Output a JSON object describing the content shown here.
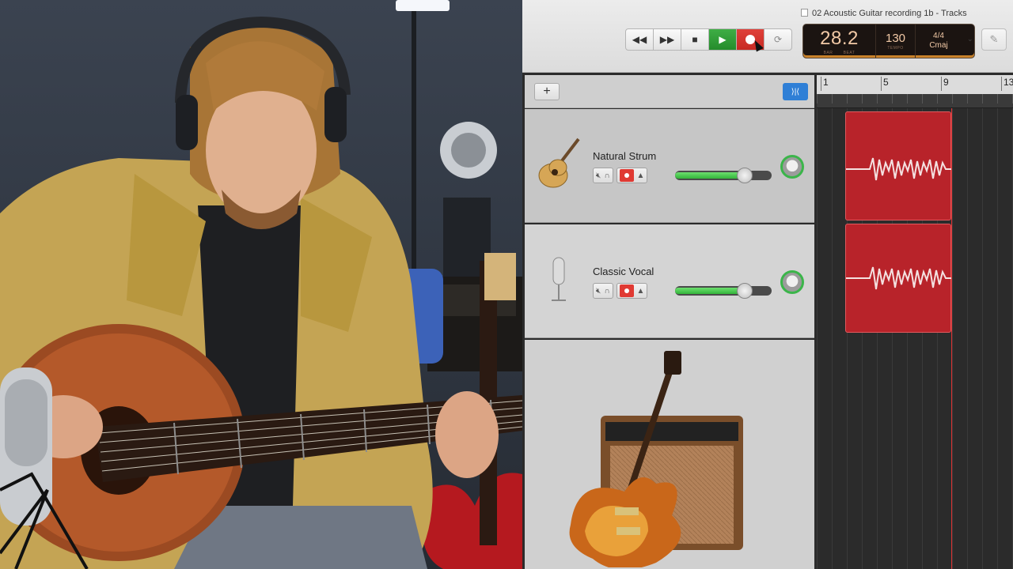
{
  "window": {
    "title": "02 Acoustic Guitar recording 1b - Tracks"
  },
  "transport": {
    "rewind_icon": "rewind-icon",
    "forward_icon": "fast-forward-icon",
    "stop_icon": "stop-icon",
    "play_icon": "play-icon",
    "record_icon": "record-icon",
    "cycle_icon": "cycle-icon"
  },
  "lcd": {
    "position": "28.2",
    "bar_label": "BAR",
    "beat_label": "BEAT",
    "tempo": "130",
    "tempo_label": "TEMPO",
    "time_signature": "4/4",
    "key": "Cmaj"
  },
  "toolbar": {
    "add_track": "+",
    "catch_label": "⟩|⟨",
    "editor_icon": "✎"
  },
  "ruler": {
    "marks": [
      "1",
      "5",
      "9",
      "13"
    ]
  },
  "tracks": [
    {
      "name": "Natural Strum",
      "icon": "acoustic-guitar-icon",
      "volume": 0.72,
      "record_armed": true
    },
    {
      "name": "Classic Vocal",
      "icon": "microphone-icon",
      "volume": 0.72,
      "record_armed": true
    }
  ],
  "colors": {
    "region": "#b8232a",
    "play": "#2e9e35",
    "record": "#d7332c",
    "accent": "#2f7fd6"
  }
}
